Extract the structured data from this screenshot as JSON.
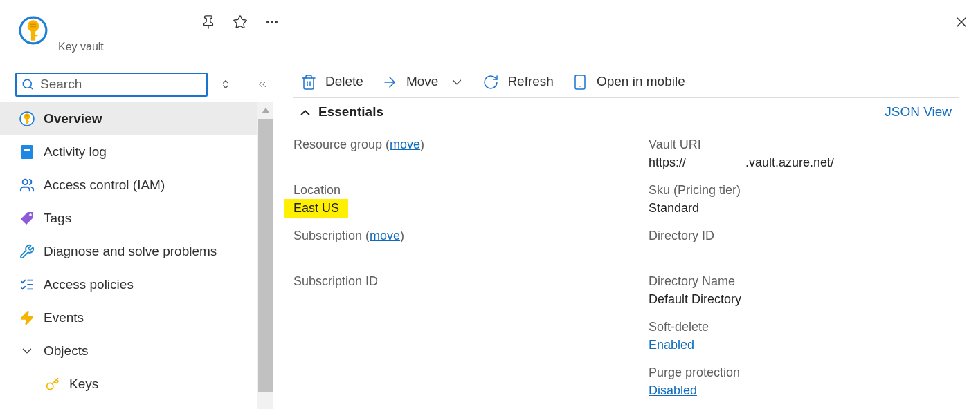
{
  "header": {
    "subtitle": "Key vault"
  },
  "search": {
    "placeholder": "Search"
  },
  "sidebar": {
    "items": [
      {
        "label": "Overview",
        "kind": "vault",
        "selected": true
      },
      {
        "label": "Activity log",
        "kind": "log",
        "selected": false
      },
      {
        "label": "Access control (IAM)",
        "kind": "people",
        "selected": false
      },
      {
        "label": "Tags",
        "kind": "tag",
        "selected": false
      },
      {
        "label": "Diagnose and solve problems",
        "kind": "tools",
        "selected": false
      },
      {
        "label": "Access policies",
        "kind": "checklist",
        "selected": false
      },
      {
        "label": "Events",
        "kind": "bolt",
        "selected": false
      },
      {
        "label": "Objects",
        "selected": false,
        "expanded": true,
        "children": [
          {
            "label": "Keys",
            "kind": "key",
            "selected": false
          }
        ]
      }
    ]
  },
  "toolbar": [
    {
      "label": "Delete",
      "kind": "trash",
      "dropdown": false
    },
    {
      "label": "Move",
      "kind": "arrow",
      "dropdown": true
    },
    {
      "label": "Refresh",
      "kind": "refresh",
      "dropdown": false
    },
    {
      "label": "Open in mobile",
      "kind": "phone",
      "dropdown": false
    }
  ],
  "essentials": {
    "title": "Essentials",
    "expanded": true,
    "json_view": "JSON View",
    "left": [
      {
        "label": "Resource group",
        "link_before": "(",
        "link": "move",
        "link_after": ")",
        "kind": "redacted"
      },
      {
        "label": "Location",
        "value": "East US",
        "kind": "text",
        "highlight": true
      },
      {
        "label": "Subscription",
        "link_before": "(",
        "link": "move",
        "link_after": ")",
        "kind": "redacted"
      },
      {
        "label": "Subscription ID",
        "kind": "blank"
      }
    ],
    "right": [
      {
        "label": "Vault URI",
        "value": "https://",
        "value_end": ".vault.azure.net/",
        "kind": "uri"
      },
      {
        "label": "Sku (Pricing tier)",
        "value": "Standard",
        "kind": "text"
      },
      {
        "label": "Directory ID",
        "kind": "blank"
      },
      {
        "label": "Directory Name",
        "value": "Default Directory",
        "kind": "text"
      },
      {
        "label": "Soft-delete",
        "value": "Enabled",
        "kind": "link"
      },
      {
        "label": "Purge protection",
        "value": "Disabled",
        "kind": "link"
      }
    ]
  }
}
